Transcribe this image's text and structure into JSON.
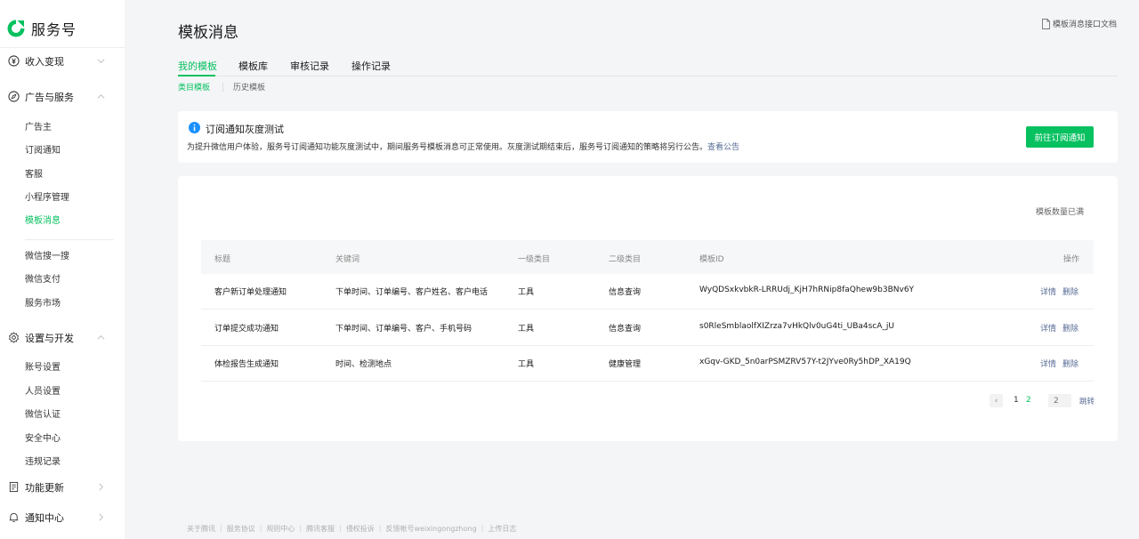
{
  "brand": {
    "name": "服务号",
    "color": "#07c160",
    "link_color": "#576b95"
  },
  "sidebar": {
    "groups": [
      {
        "label": "收入变现",
        "icon": "yen-circle-icon",
        "expanded": false
      },
      {
        "label": "广告与服务",
        "icon": "compass-icon",
        "expanded": true,
        "items": [
          "广告主",
          "订阅通知",
          "客服",
          "小程序管理",
          "模板消息",
          "微信搜一搜",
          "微信支付",
          "服务市场"
        ]
      },
      {
        "label": "设置与开发",
        "icon": "gear-icon",
        "expanded": true,
        "items": [
          "账号设置",
          "人员设置",
          "微信认证",
          "安全中心",
          "违规记录"
        ]
      },
      {
        "label": "功能更新",
        "icon": "update-doc-icon",
        "expanded": false
      },
      {
        "label": "通知中心",
        "icon": "bell-icon",
        "expanded": false
      }
    ],
    "active_item": "模板消息"
  },
  "header": {
    "title": "模板消息",
    "doc_link": "模板消息接口文档"
  },
  "tabs": [
    "我的模板",
    "模板库",
    "审核记录",
    "操作记录"
  ],
  "active_tab": "我的模板",
  "subtabs": [
    "类目模板",
    "历史模板"
  ],
  "active_subtab": "类目模板",
  "notice": {
    "title": "订阅通知灰度测试",
    "description": "为提升微信用户体验，服务号订阅通知功能灰度测试中，期间服务号模板消息可正常使用。灰度测试期结束后，服务号订阅通知的策略将另行公告。",
    "link": "查看公告",
    "button": "前往订阅通知"
  },
  "quota_text": "模板数量已满",
  "table": {
    "headers": [
      "标题",
      "关键词",
      "一级类目",
      "二级类目",
      "模板ID",
      "操作"
    ],
    "rows": [
      {
        "title": "客户新订单处理通知",
        "keywords": "下单时间、订单编号、客户姓名、客户电话",
        "cat1": "工具",
        "cat2": "信息查询",
        "id": "WyQDSxkvbkR-LRRUdj_KjH7hRNip8faQhew9b3BNv6Y",
        "detail": "详情",
        "delete": "删除"
      },
      {
        "title": "订单提交成功通知",
        "keywords": "下单时间、订单编号、客户、手机号码",
        "cat1": "工具",
        "cat2": "信息查询",
        "id": "s0RleSmblaolfXIZrza7vHkQlv0uG4ti_UBa4scA_jU",
        "detail": "详情",
        "delete": "删除"
      },
      {
        "title": "体检报告生成通知",
        "keywords": "时间、检测地点",
        "cat1": "工具",
        "cat2": "健康管理",
        "id": "xGqv-GKD_5n0arPSMZRV57Y-t2JYve0Ry5hDP_XA19Q",
        "detail": "详情",
        "delete": "删除"
      }
    ]
  },
  "pagination": {
    "prev": "‹",
    "pages": [
      "1",
      "2"
    ],
    "current": "2",
    "input_placeholder": "2",
    "jump": "跳转"
  },
  "footer": [
    "关于腾讯",
    "服务协议",
    "规则中心",
    "腾讯客服",
    "侵权投诉",
    "反馈帐号weixingongzhong",
    "上传日志"
  ]
}
